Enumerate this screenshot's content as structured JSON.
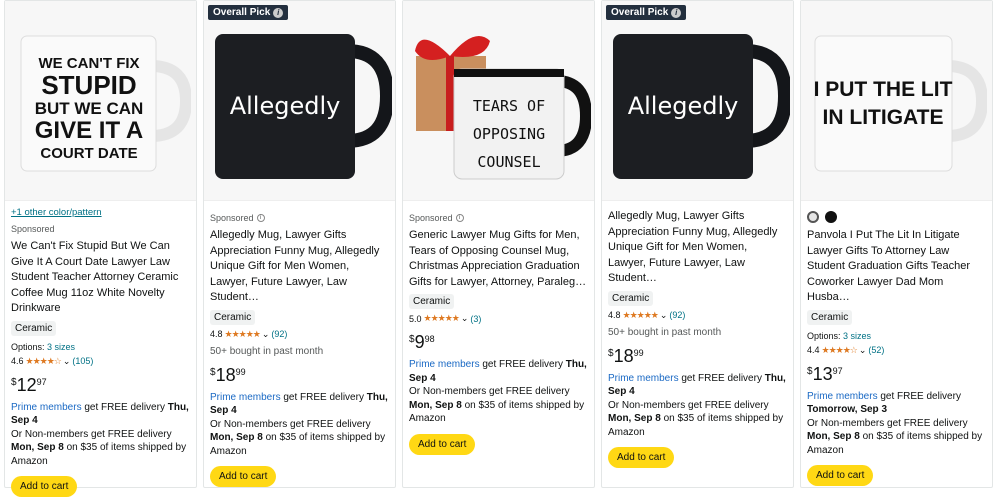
{
  "products": [
    {
      "badge": "",
      "mug_text": "WE CAN'T FIX STUPID BUT WE CAN GIVE IT A COURT DATE",
      "other_color": "+1 other color/pattern",
      "sponsored": "Sponsored",
      "title": "We Can't Fix Stupid But We Can Give It A Court Date Lawyer Law Student Teacher Attorney Ceramic Coffee Mug 11oz White Novelty Drinkware",
      "material": "Ceramic",
      "options_label": "Options:",
      "options_value": "3 sizes",
      "rating": "4.6",
      "stars": "★★★★☆",
      "reviews": "(105)",
      "bought": "",
      "price_symbol": "$",
      "price_whole": "12",
      "price_frac": "97",
      "prime": "Prime members",
      "delivery_text": " get FREE delivery ",
      "delivery_date": "Thu, Sep 4",
      "nonmember_text": "Or Non-members get FREE delivery ",
      "nonmember_date": "Mon, Sep 8",
      "nonmember_tail": " on $35 of items shipped by Amazon",
      "cart": "Add to cart"
    },
    {
      "badge": "Overall Pick",
      "mug_text": "Allegedly",
      "sponsored": "Sponsored",
      "title": "Allegedly Mug, Lawyer Gifts Appreciation Funny Mug, Allegedly Unique Gift for Men Women, Lawyer, Future Lawyer, Law Student…",
      "material": "Ceramic",
      "rating": "4.8",
      "stars": "★★★★★",
      "reviews": "(92)",
      "bought": "50+ bought in past month",
      "price_symbol": "$",
      "price_whole": "18",
      "price_frac": "99",
      "prime": "Prime members",
      "delivery_text": " get FREE delivery ",
      "delivery_date": "Thu, Sep 4",
      "nonmember_text": "Or Non-members get FREE delivery ",
      "nonmember_date": "Mon, Sep 8",
      "nonmember_tail": " on $35 of items shipped by Amazon",
      "cart": "Add to cart"
    },
    {
      "badge": "",
      "mug_text": "TEARS OF OPPOSING COUNSEL",
      "sponsored": "Sponsored",
      "title": "Generic Lawyer Mug Gifts for Men, Tears of Opposing Counsel Mug, Christmas Appreciation Graduation Gifts for Lawyer, Attorney, Paraleg…",
      "material": "Ceramic",
      "rating": "5.0",
      "stars": "★★★★★",
      "reviews": "(3)",
      "bought": "",
      "price_symbol": "$",
      "price_whole": "9",
      "price_frac": "98",
      "prime": "Prime members",
      "delivery_text": " get FREE delivery ",
      "delivery_date": "Thu, Sep 4",
      "nonmember_text": "Or Non-members get FREE delivery ",
      "nonmember_date": "Mon, Sep 8",
      "nonmember_tail": " on $35 of items shipped by Amazon",
      "cart": "Add to cart"
    },
    {
      "badge": "Overall Pick",
      "mug_text": "Allegedly",
      "title": "Allegedly Mug, Lawyer Gifts Appreciation Funny Mug, Allegedly Unique Gift for Men Women, Lawyer, Future Lawyer, Law Student…",
      "material": "Ceramic",
      "rating": "4.8",
      "stars": "★★★★★",
      "reviews": "(92)",
      "bought": "50+ bought in past month",
      "price_symbol": "$",
      "price_whole": "18",
      "price_frac": "99",
      "prime": "Prime members",
      "delivery_text": " get FREE delivery ",
      "delivery_date": "Thu, Sep 4",
      "nonmember_text": "Or Non-members get FREE delivery ",
      "nonmember_date": "Mon, Sep 8",
      "nonmember_tail": " on $35 of items shipped by Amazon",
      "cart": "Add to cart"
    },
    {
      "badge": "",
      "mug_text": "I PUT THE LIT IN LITIGATE",
      "title": "Panvola I Put The Lit In Litigate Lawyer Gifts To Attorney Law Student Graduation Gifts Teacher Coworker Lawyer Dad Mom Husba…",
      "material": "Ceramic",
      "options_label": "Options:",
      "options_value": "3 sizes",
      "rating": "4.4",
      "stars": "★★★★☆",
      "reviews": "(52)",
      "bought": "",
      "price_symbol": "$",
      "price_whole": "13",
      "price_frac": "97",
      "prime": "Prime members",
      "delivery_text": " get FREE delivery ",
      "delivery_date": "Tomorrow, Sep 3",
      "nonmember_text": "Or Non-members get FREE delivery ",
      "nonmember_date": "Mon, Sep 8",
      "nonmember_tail": " on $35 of items shipped by Amazon",
      "cart": "Add to cart"
    }
  ],
  "colors": {
    "cart_button": "#ffd814",
    "prime_blue": "#1a69c4",
    "star_orange": "#de7921",
    "link_teal": "#007185",
    "badge_bg": "#232f3e"
  }
}
